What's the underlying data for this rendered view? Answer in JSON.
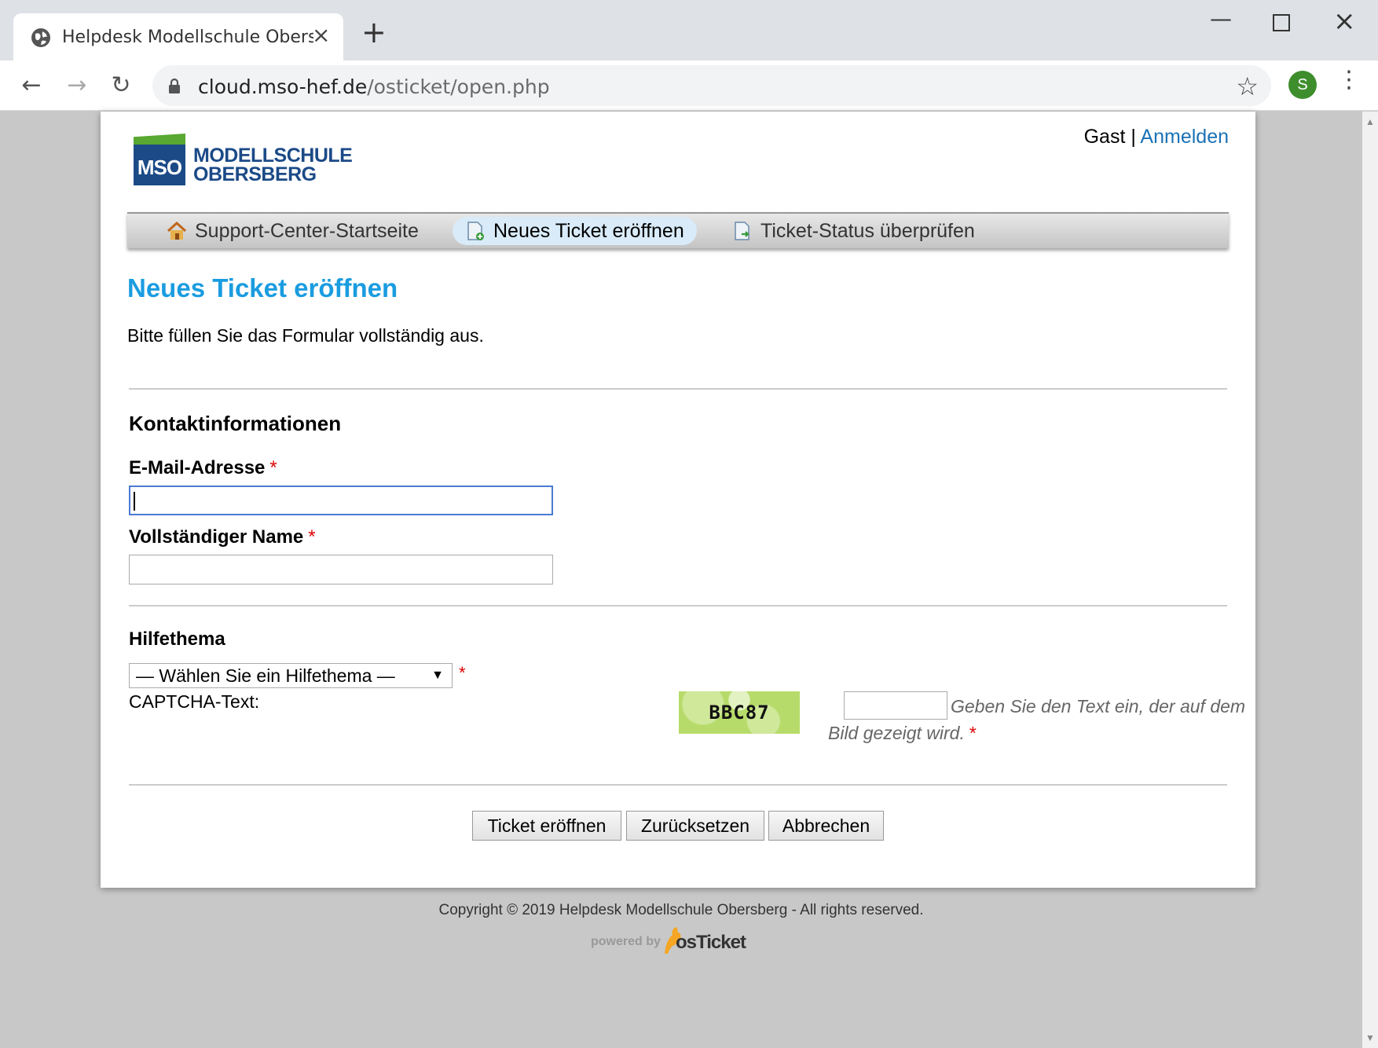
{
  "browser": {
    "tab_title": "Helpdesk Modellschule Obersberg",
    "url_host": "cloud.mso-hef.de",
    "url_path": "/osticket/open.php",
    "profile_initial": "S"
  },
  "header": {
    "logo_abbr": "MSO",
    "logo_line1": "MODELLSCHULE",
    "logo_line2": "OBERSBERG",
    "user_label": "Gast",
    "separator": "|",
    "login_link": "Anmelden"
  },
  "nav": {
    "items": [
      {
        "label": "Support-Center-Startseite",
        "icon": "home-icon"
      },
      {
        "label": "Neues Ticket eröffnen",
        "icon": "new-ticket-icon",
        "active": true
      },
      {
        "label": "Ticket-Status überprüfen",
        "icon": "ticket-status-icon"
      }
    ]
  },
  "page": {
    "title": "Neues Ticket eröffnen",
    "intro": "Bitte füllen Sie das Formular vollständig aus."
  },
  "contact": {
    "heading": "Kontaktinformationen",
    "email_label": "E-Mail-Adresse",
    "email_value": "",
    "name_label": "Vollständiger Name",
    "name_value": "",
    "required_mark": "*"
  },
  "topic": {
    "heading": "Hilfethema",
    "selected": "— Wählen Sie ein Hilfethema —",
    "arrow": "▼"
  },
  "captcha": {
    "label": "CAPTCHA-Text:",
    "image_text": "BBC87",
    "hint": "Geben Sie den Text ein, der auf dem Bild gezeigt wird."
  },
  "buttons": {
    "submit": "Ticket eröffnen",
    "reset": "Zurücksetzen",
    "cancel": "Abbrechen"
  },
  "footer": {
    "copyright": "Copyright © 2019 Helpdesk Modellschule Obersberg - All rights reserved.",
    "powered_by": "powered by",
    "powered_brand": "osTicket"
  },
  "colors": {
    "accent": "#1a9ce0",
    "link": "#1a72b5",
    "brand_blue": "#1b4a87",
    "brand_green": "#58a831",
    "required": "#dd0000"
  }
}
